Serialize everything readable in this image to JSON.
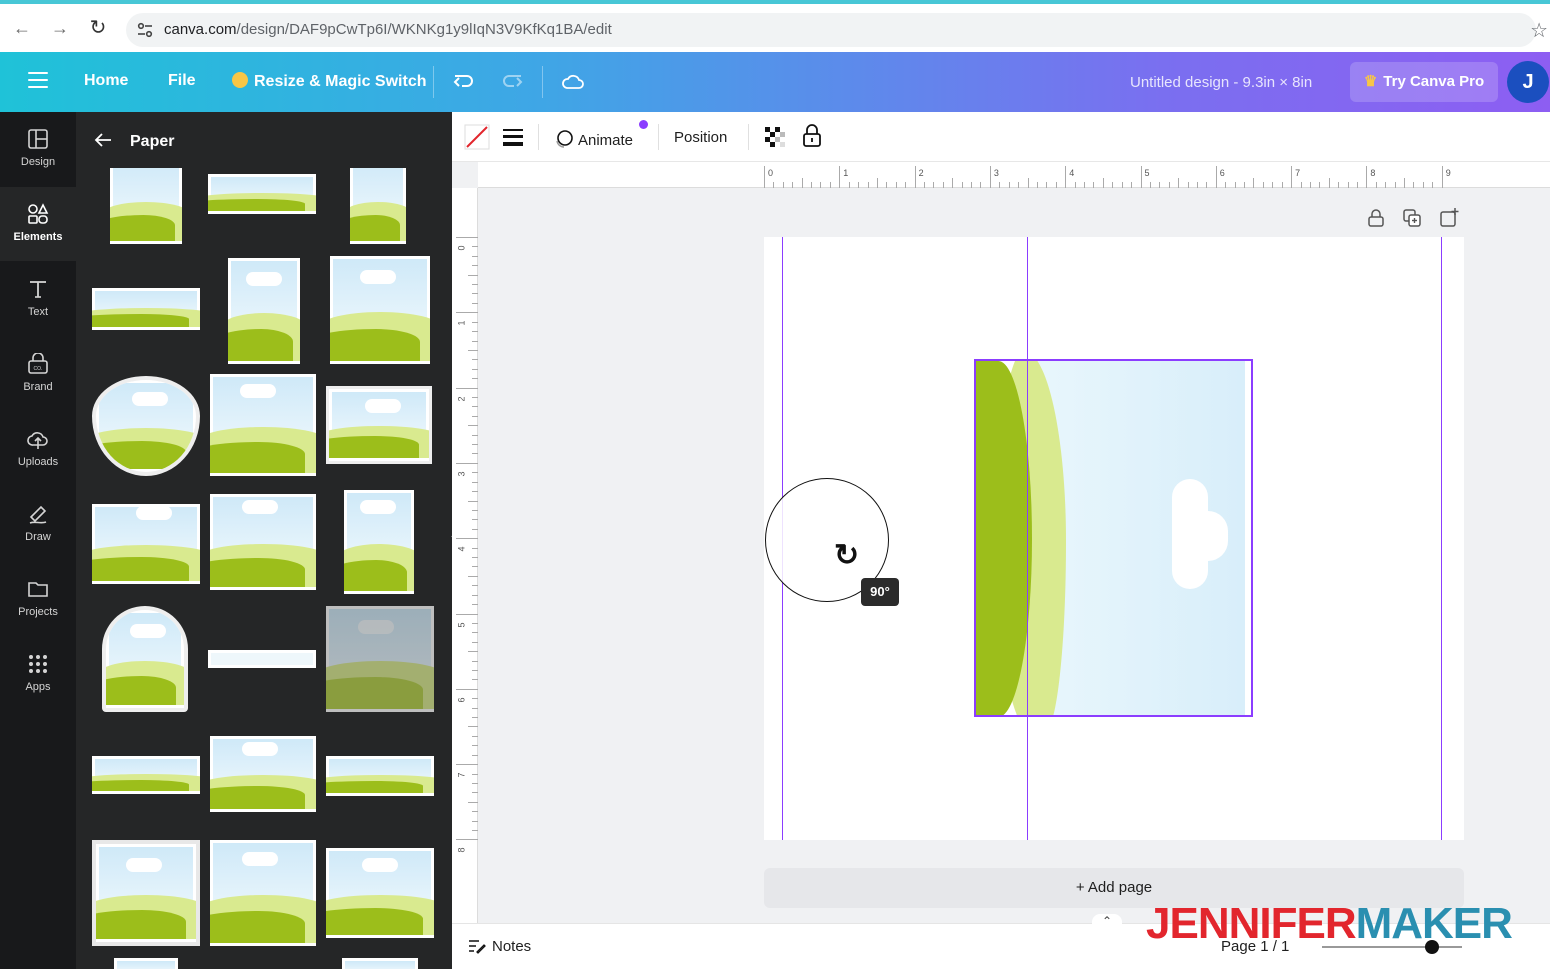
{
  "browser": {
    "url_host": "canva.com",
    "url_path": "/design/DAF9pCwTp6I/WKNKg1y9lIqN3V9KfKq1BA/edit",
    "back_icon": "arrow-left-icon",
    "forward_icon": "arrow-right-icon",
    "reload_icon": "reload-icon",
    "bookmark_icon": "star-icon"
  },
  "header": {
    "home_label": "Home",
    "file_label": "File",
    "resize_label": "Resize & Magic Switch",
    "design_title": "Untitled design - 9.3in × 8in",
    "try_pro_label": "Try Canva Pro",
    "avatar_initial": "J",
    "gradient_start": "#1fc2d8",
    "gradient_end": "#8d5ef2"
  },
  "rail": {
    "items": [
      {
        "label": "Design",
        "icon": "layout-icon"
      },
      {
        "label": "Elements",
        "icon": "shapes-icon"
      },
      {
        "label": "Text",
        "icon": "text-icon"
      },
      {
        "label": "Brand",
        "icon": "brand-icon"
      },
      {
        "label": "Uploads",
        "icon": "cloud-upload-icon"
      },
      {
        "label": "Draw",
        "icon": "draw-icon"
      },
      {
        "label": "Projects",
        "icon": "folder-icon"
      },
      {
        "label": "Apps",
        "icon": "apps-grid-icon"
      }
    ],
    "active": "Elements"
  },
  "panel": {
    "title": "Paper"
  },
  "toolbar": {
    "animate_label": "Animate",
    "position_label": "Position"
  },
  "rulers": {
    "top": [
      "0",
      "1",
      "2",
      "3",
      "4",
      "5",
      "6",
      "7",
      "8",
      "9"
    ],
    "left": [
      "0",
      "1",
      "2",
      "3",
      "4",
      "5",
      "6",
      "7",
      "8"
    ]
  },
  "canvas": {
    "rotation_label": "90°",
    "add_page_label": "+ Add page",
    "accent_color": "#8b3dff"
  },
  "footer": {
    "notes_label": "Notes",
    "page_count": "Page 1 / 1"
  },
  "watermark": {
    "part_a": "JENNIFER",
    "part_b": "MAKER"
  }
}
